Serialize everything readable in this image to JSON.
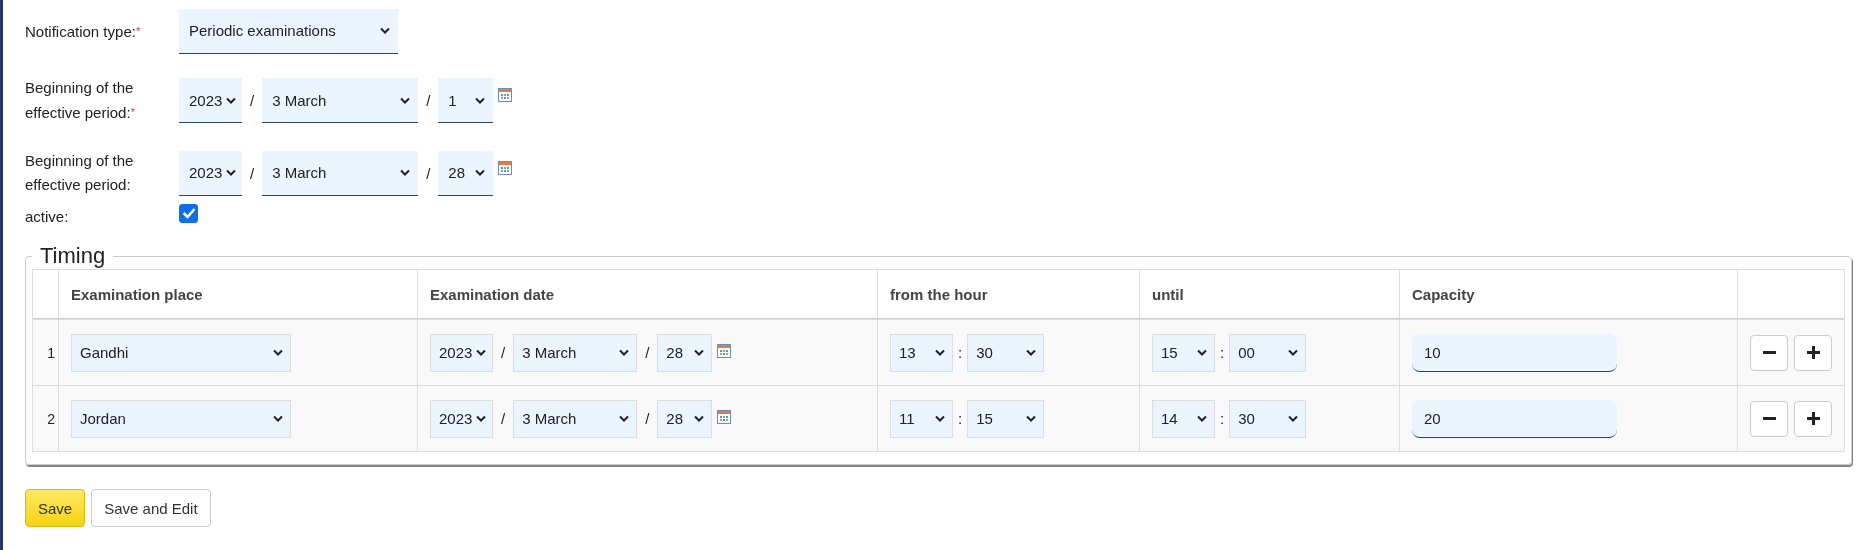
{
  "required_mark": "*",
  "date_separator": "/",
  "time_separator": ":",
  "fields": [
    {
      "kind": "select",
      "label": "Notification type:",
      "required": true,
      "value": "Periodic examinations"
    },
    {
      "kind": "date",
      "label": "Beginning of the effective period:",
      "required": true,
      "year": "2023",
      "month": "3 March",
      "day": "1"
    },
    {
      "kind": "date",
      "label": "Beginning of the effective period:",
      "required": false,
      "year": "2023",
      "month": "3 March",
      "day": "28"
    },
    {
      "kind": "checkbox",
      "label": "active:",
      "required": false,
      "checked": true
    }
  ],
  "timing": {
    "legend": "Timing",
    "columns": [
      "Examination place",
      "Examination date",
      "from the hour",
      "until",
      "Capacity"
    ],
    "rows": [
      {
        "number": "1",
        "place": "Gandhi",
        "date": {
          "year": "2023",
          "month": "3 March",
          "day": "28"
        },
        "from": {
          "hour": "13",
          "minute": "30"
        },
        "until": {
          "hour": "15",
          "minute": "00"
        },
        "capacity": "10"
      },
      {
        "number": "2",
        "place": "Jordan",
        "date": {
          "year": "2023",
          "month": "3 March",
          "day": "28"
        },
        "from": {
          "hour": "11",
          "minute": "15"
        },
        "until": {
          "hour": "14",
          "minute": "30"
        },
        "capacity": "20"
      }
    ]
  },
  "buttons": [
    {
      "label": "Save",
      "kind": "primary"
    },
    {
      "label": "Save and Edit",
      "kind": "secondary"
    }
  ]
}
